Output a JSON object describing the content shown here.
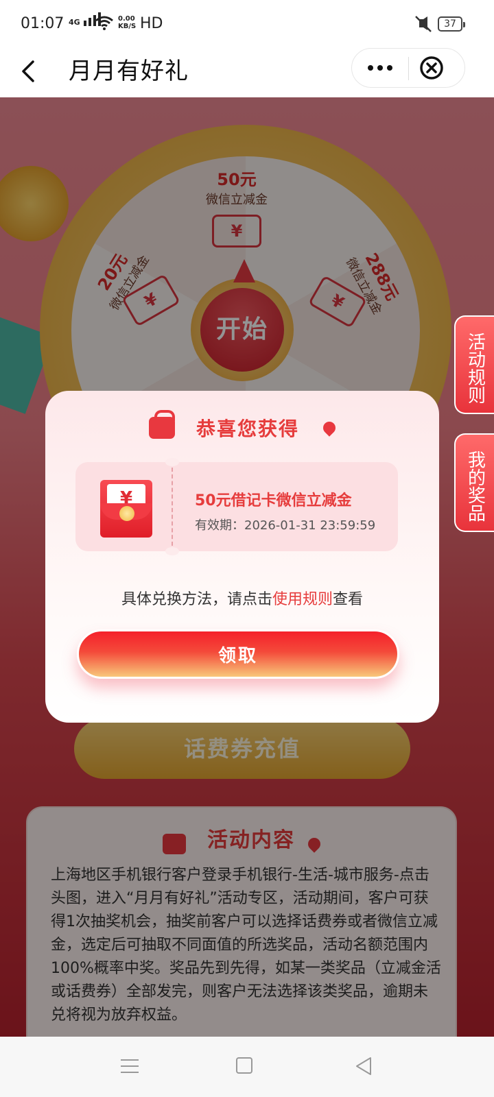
{
  "status_bar": {
    "time": "01:07",
    "network": "4G",
    "speed_top": "0.00",
    "speed_bottom": "KB/S",
    "hd": "HD",
    "battery": "37"
  },
  "nav": {
    "title": "月月有好礼"
  },
  "wheel": {
    "start_label": "开始",
    "prizes": [
      {
        "amount": "50元",
        "desc": "微信立减金",
        "icon": "¥"
      },
      {
        "amount": "20元",
        "desc": "微信立减金",
        "icon": "¥"
      },
      {
        "amount": "288元",
        "desc": "微信立减金",
        "icon": "¥"
      }
    ]
  },
  "side_tabs": {
    "rules": "活动规则",
    "my_prizes": "我的奖品"
  },
  "recharge_button": "话费券充值",
  "rules_card": {
    "heading": "活动内容",
    "text": "上海地区手机银行客户登录手机银行-生活-城市服务-点击头图，进入“月月有好礼”活动专区，活动期间，客户可获得1次抽奖机会，抽奖前客户可以选择话费券或者微信立减金，选定后可抽取不同面值的所选奖品，活动名额范围内100%概率中奖。奖品先到先得，如某一类奖品（立减金活或话费券）全部发完，则客户无法选择该类奖品，逾期未兑将视为放弃权益。"
  },
  "popup": {
    "title": "恭喜您获得",
    "redpacket_symbol": "¥",
    "prize_name": "50元借记卡微信立减金",
    "validity": "有效期：2026-01-31 23:59:59",
    "hint_prefix": "具体兑换方法，请点击",
    "hint_link": "使用规则",
    "hint_suffix": "查看",
    "claim_label": "领取"
  },
  "colors": {
    "accent": "#e63c3c",
    "claim_top": "#f5212b",
    "claim_bottom": "#f8c77a"
  }
}
